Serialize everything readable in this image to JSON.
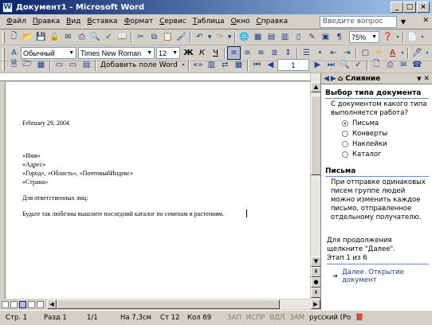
{
  "window": {
    "title": "Документ1 - Microsoft Word",
    "app_icon": "W"
  },
  "menu": {
    "items": [
      "Файл",
      "Правка",
      "Вид",
      "Вставка",
      "Формат",
      "Сервис",
      "Таблица",
      "Окно",
      "Справка"
    ],
    "help_placeholder": "Введите вопрос"
  },
  "formatting": {
    "style": "Обычный",
    "font": "Times New Roman",
    "size": "12",
    "zoom": "75%",
    "mail_merge_field": "Добавить поле Word",
    "record": "1"
  },
  "document": {
    "lines": [
      "February 29, 2004",
      "«Имя»",
      "«Адрес»",
      "«Город», «Область», «ПочтовыйИндекс»",
      "«Страна»",
      "Для ответственных лиц:",
      "Будьте так любезны вышлите последний каталог по семенам и растениям."
    ]
  },
  "taskpane": {
    "title": "Слияние",
    "section1": "Выбор типа документа",
    "question": "С документом какого типа выполняется работа?",
    "options": [
      "Письма",
      "Конверты",
      "Наклейки",
      "Каталог"
    ],
    "selected": 0,
    "section2": "Письма",
    "description": "При отправке одинаковых писем группе людей можно изменить каждое письмо, отправленное отдельному получателю.",
    "continue_text": "Для продолжения щелкните \"Далее\".",
    "step": "Этап 1 из 6",
    "next_link": "Далее. Открытие документ"
  },
  "status": {
    "page": "Стр. 1",
    "section": "Разд 1",
    "pages": "1/1",
    "at": "На 7,3см",
    "line": "Ст 12",
    "col": "Кол 69",
    "rec": "ЗАП",
    "trk": "ИСПР",
    "ext": "ВДЛ",
    "ovr": "ЗАМ",
    "lang": "русский (Ро"
  },
  "colors": {
    "title_start": "#0a246a",
    "title_end": "#a6caf0",
    "link": "#1c3f94"
  }
}
